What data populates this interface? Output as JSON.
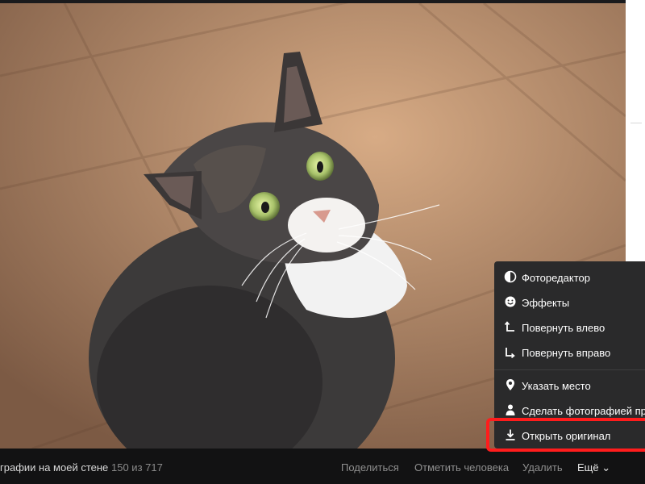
{
  "menu": {
    "items": [
      {
        "label": "Фоторедактор",
        "icon": "contrast-icon"
      },
      {
        "label": "Эффекты",
        "icon": "smile-icon"
      },
      {
        "label": "Повернуть влево",
        "icon": "rotate-left-icon"
      },
      {
        "label": "Повернуть вправо",
        "icon": "rotate-right-icon"
      },
      {
        "label": "Указать место",
        "icon": "location-pin-icon"
      },
      {
        "label": "Сделать фотографией про",
        "icon": "person-icon"
      },
      {
        "label": "Открыть оригинал",
        "icon": "download-icon"
      }
    ]
  },
  "bottom_bar": {
    "album": "графии на моей стене",
    "counter": "150 из 717",
    "share": "Поделиться",
    "tag_person": "Отметить человека",
    "delete": "Удалить",
    "more": "Ещё ⌄"
  },
  "colors": {
    "menu_bg": "#2a2a2b",
    "highlight": "#ff1c1c",
    "bar_bg": "#121213"
  }
}
